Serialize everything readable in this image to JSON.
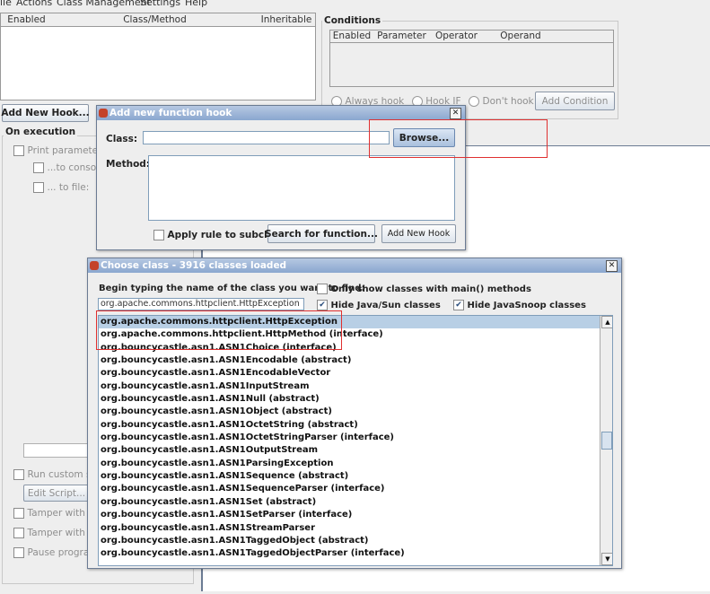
{
  "menu": [
    "ile",
    "Actions",
    "Class Management",
    "Settings",
    "Help"
  ],
  "hooks_table": {
    "columns": [
      "Enabled",
      "Class/Method",
      "Inheritable"
    ]
  },
  "conditions": {
    "title": "Conditions",
    "columns": [
      "Enabled",
      "Parameter",
      "Operator",
      "Operand"
    ],
    "radios": [
      "Always hook",
      "Hook IF",
      "Don't hook IF"
    ],
    "add_condition": "Add Condition"
  },
  "left_panel": {
    "add_new_hook": "Add New Hook...",
    "on_execution": "On execution",
    "print_parameters": "Print parameters",
    "to_console": "...to console",
    "to_file": "... to file:",
    "run_custom_script": "Run custom sc",
    "edit_script": "Edit Script...",
    "tamper_params": "Tamper with pa",
    "tamper_return": "Tamper with re",
    "pause_program": "Pause program"
  },
  "add_hook_dialog": {
    "title": "Add new function hook",
    "class_label": "Class:",
    "class_value": "",
    "browse": "Browse...",
    "method_label": "Method:",
    "apply_rule": "Apply rule to subclasses",
    "search_function": "Search for function...",
    "add_new_hook": "Add New Hook"
  },
  "choose_class_dialog": {
    "title": "Choose class - 3916 classes loaded",
    "prompt": "Begin typing the name of the class you want to find:",
    "search_value": "org.apache.commons.httpclient.HttpException",
    "only_main": "Only show classes with main() methods",
    "hide_java_sun": "Hide Java/Sun classes",
    "hide_javasnoop": "Hide JavaSnoop classes",
    "only_main_checked": false,
    "hide_java_sun_checked": true,
    "hide_javasnoop_checked": true,
    "classes": [
      "org.apache.commons.httpclient.HttpException",
      "org.apache.commons.httpclient.HttpMethod (interface)",
      "org.bouncycastle.asn1.ASN1Choice (interface)",
      "org.bouncycastle.asn1.ASN1Encodable (abstract)",
      "org.bouncycastle.asn1.ASN1EncodableVector",
      "org.bouncycastle.asn1.ASN1InputStream",
      "org.bouncycastle.asn1.ASN1Null (abstract)",
      "org.bouncycastle.asn1.ASN1Object (abstract)",
      "org.bouncycastle.asn1.ASN1OctetString (abstract)",
      "org.bouncycastle.asn1.ASN1OctetStringParser (interface)",
      "org.bouncycastle.asn1.ASN1OutputStream",
      "org.bouncycastle.asn1.ASN1ParsingException",
      "org.bouncycastle.asn1.ASN1Sequence (abstract)",
      "org.bouncycastle.asn1.ASN1SequenceParser (interface)",
      "org.bouncycastle.asn1.ASN1Set (abstract)",
      "org.bouncycastle.asn1.ASN1SetParser (interface)",
      "org.bouncycastle.asn1.ASN1StreamParser",
      "org.bouncycastle.asn1.ASN1TaggedObject (abstract)",
      "org.bouncycastle.asn1.ASN1TaggedObjectParser (interface)"
    ],
    "selected_index": 0
  },
  "colors": {
    "selection": "#b8cfe5",
    "titlebar": "#8aa7cf",
    "annotation": "#e03030"
  }
}
